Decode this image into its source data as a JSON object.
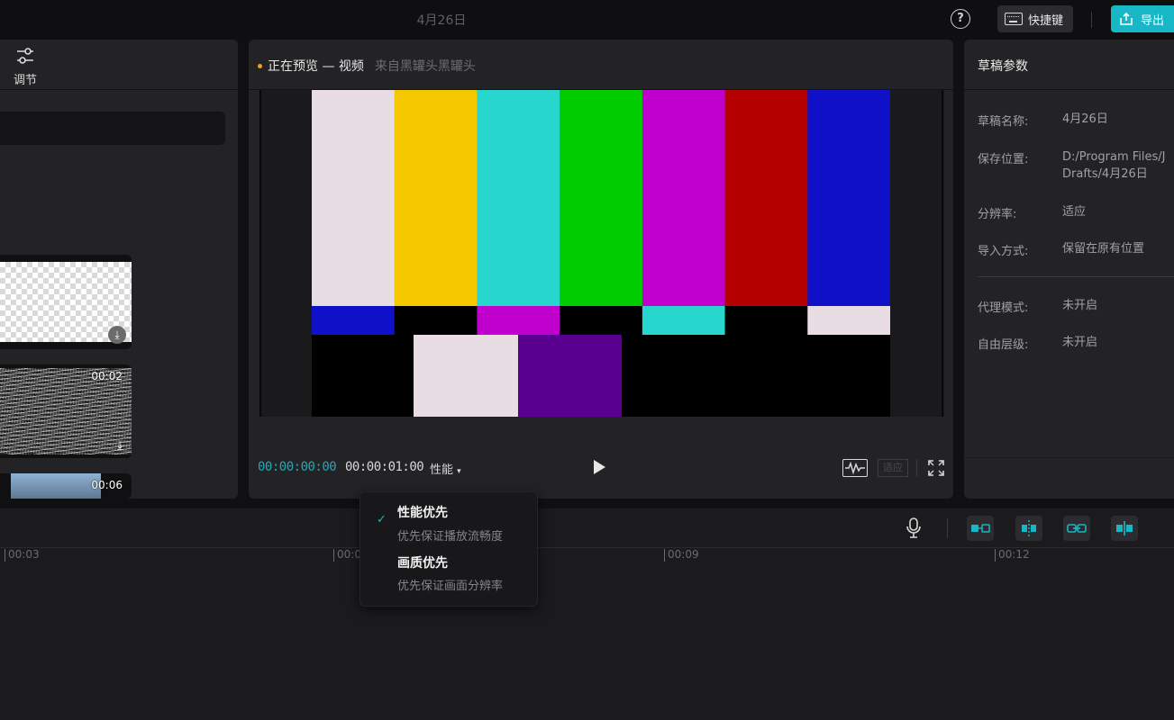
{
  "topbar": {
    "title": "4月26日",
    "help_icon": "?",
    "shortcut_label": "快捷键",
    "export_label": "导出"
  },
  "left_panel": {
    "adjust_label": "调节",
    "thumbs": [
      {
        "duration": ""
      },
      {
        "duration": "00:02"
      },
      {
        "duration": "00:06"
      }
    ]
  },
  "preview": {
    "title": "正在预览 — 视频",
    "source": "来自黑罐头黑罐头",
    "time_current": "00:00:00:00",
    "time_total": "00:00:01:00",
    "perf_label": "性能",
    "fit_label": "适应",
    "colorbars": {
      "top": [
        "#e7dde2",
        "#f5c800",
        "#27d7cd",
        "#00cc00",
        "#c000cc",
        "#b50000",
        "#1010c8"
      ],
      "mid": [
        "#1010c8",
        "#000000",
        "#c000cc",
        "#000000",
        "#27d7cd",
        "#000000",
        "#e7dde2"
      ],
      "bottom": [
        "#000000",
        "#e7dde2",
        "#5a0090",
        "#000000"
      ]
    }
  },
  "draft_params": {
    "title": "草稿参数",
    "items": [
      {
        "label": "草稿名称:",
        "value": "4月26日"
      },
      {
        "label": "保存位置:",
        "value": "D:/Program Files/J",
        "value2": "Drafts/4月26日"
      },
      {
        "label": "分辨率:",
        "value": "适应"
      },
      {
        "label": "导入方式:",
        "value": "保留在原有位置"
      },
      {
        "label": "代理模式:",
        "value": "未开启"
      },
      {
        "label": "自由层级:",
        "value": "未开启"
      }
    ]
  },
  "timeline": {
    "ticks": [
      "00:03",
      "00:0",
      "00:09",
      "00:12"
    ]
  },
  "perf_dropdown": {
    "options": [
      {
        "title": "性能优先",
        "desc": "优先保证播放流畅度",
        "selected": true
      },
      {
        "title": "画质优先",
        "desc": "优先保证画面分辨率",
        "selected": false
      }
    ]
  },
  "colors": {
    "accent": "#18b7c6",
    "panel": "#232326",
    "background": "#101012"
  }
}
